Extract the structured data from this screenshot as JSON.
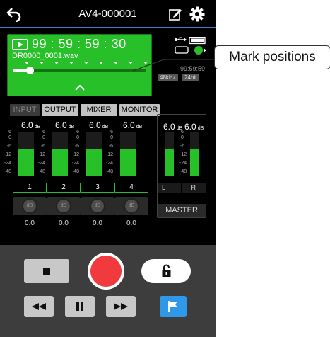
{
  "header": {
    "title": "AV4-000001",
    "back_icon": "back-arrow-icon",
    "edit_icon": "edit-icon",
    "settings_icon": "gear-icon"
  },
  "display": {
    "counter": "99 : 59 : 59 : 30",
    "filename": "DR0000_0001.wav",
    "remaining": "99:59:59",
    "sample_rate": "48kHz",
    "bit_depth": "24bit",
    "position_fraction": 0.12,
    "mark_count": 9,
    "background": "#28c028"
  },
  "tabs": [
    "INPUT",
    "OUTPUT",
    "MIXER",
    "MONITOR"
  ],
  "channels": [
    {
      "label": "1",
      "level": "6.0",
      "unit": "dB",
      "pan": "0.0",
      "knob_label": "dB",
      "meter_fraction": 0.62
    },
    {
      "label": "2",
      "level": "6.0",
      "unit": "dB",
      "pan": "0.0",
      "knob_label": "dB",
      "meter_fraction": 0.62
    },
    {
      "label": "3",
      "level": "6.0",
      "unit": "dB",
      "pan": "0.0",
      "knob_label": "dB",
      "meter_fraction": 0.62
    },
    {
      "label": "4",
      "level": "6.0",
      "unit": "dB",
      "pan": "0.0",
      "knob_label": "dB",
      "meter_fraction": 0.62
    }
  ],
  "scale_ticks": [
    "6",
    "0",
    "-6",
    "-12",
    "-24",
    "-48"
  ],
  "master": {
    "label": "MASTER",
    "left": {
      "label": "L",
      "level": "6.0",
      "unit": "dB",
      "meter_fraction": 0.62
    },
    "right": {
      "label": "R",
      "level": "6.0",
      "unit": "dB",
      "meter_fraction": 0.62
    }
  },
  "transport": {
    "stop_icon": "stop-icon",
    "record_icon": "record-icon",
    "lock_icon": "unlock-icon",
    "rewind_icon": "rewind-icon",
    "pause_icon": "pause-icon",
    "forward_icon": "fast-forward-icon",
    "mark_icon": "flag-icon"
  },
  "callout": {
    "text": "Mark positions"
  }
}
